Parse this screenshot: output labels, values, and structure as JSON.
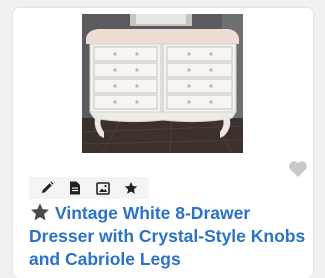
{
  "listing": {
    "title": "Vintage White 8-Drawer Dresser with Crystal-Style Knobs and Cabriole Legs",
    "image_alt": "White vintage dresser with eight drawers and crystal knobs",
    "favorite_icon": "heart-icon",
    "starred_icon": "star-icon"
  },
  "toolbar": {
    "icons": [
      "pencil-icon",
      "document-icon",
      "image-icon",
      "star-icon"
    ]
  },
  "colors": {
    "title": "#2a73c5",
    "star": "#4a4a4a",
    "heart": "#c8c8c8",
    "toolbar_bg": "#f4f4f5"
  }
}
